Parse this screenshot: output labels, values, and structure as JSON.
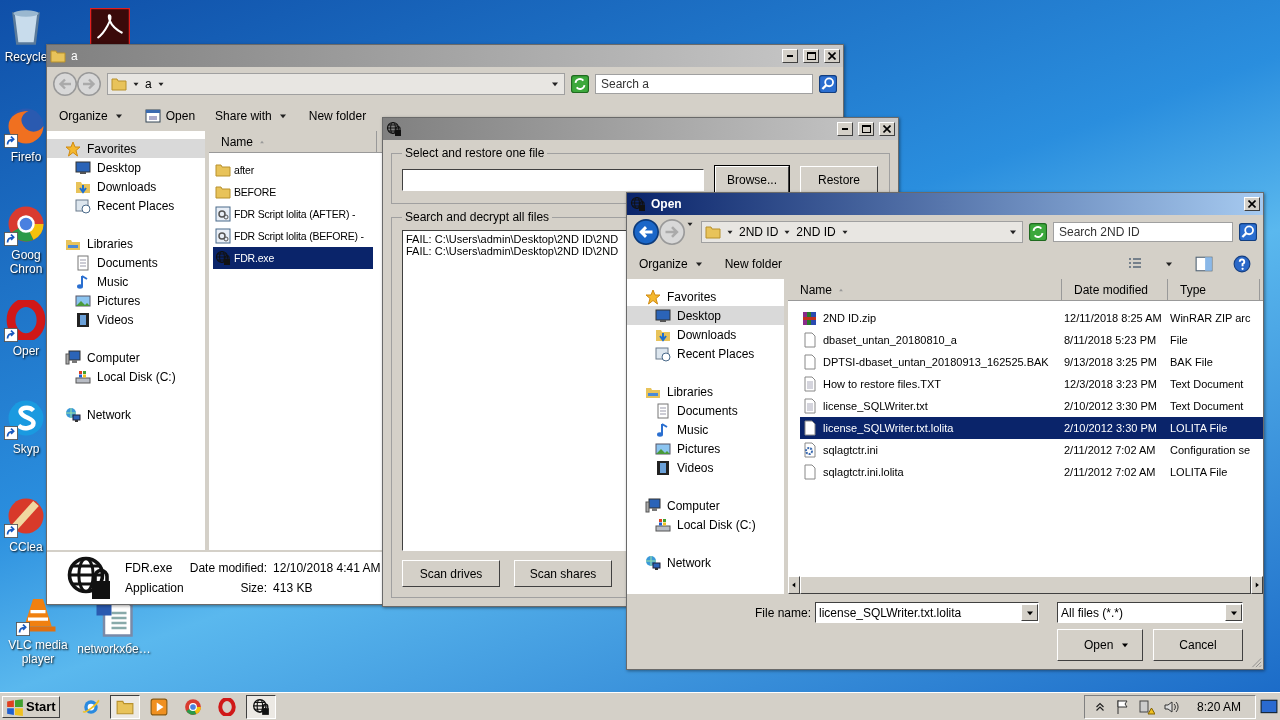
{
  "desktop_icons": [
    {
      "label": "Recycle"
    },
    {
      "label": "Firefo"
    },
    {
      "label": "Goog Chron"
    },
    {
      "label": "Oper"
    },
    {
      "label": "Skyp"
    },
    {
      "label": "CClea"
    },
    {
      "label": "VLC media player"
    },
    {
      "label": "networkxбe…"
    }
  ],
  "explorer": {
    "title": "a",
    "active": false,
    "breadcrumb": [
      "a"
    ],
    "search_placeholder": "Search a",
    "toolbar": [
      {
        "label": "Organize",
        "kind": "menu"
      },
      {
        "label": "Open",
        "kind": "icon"
      },
      {
        "label": "Share with",
        "kind": "menu"
      },
      {
        "label": "New folder",
        "kind": "plain"
      }
    ],
    "column": "Name",
    "nav": [
      {
        "label": "Favorites",
        "selected": true,
        "children": [
          {
            "label": "Desktop",
            "selected": false
          },
          {
            "label": "Downloads",
            "selected": false
          },
          {
            "label": "Recent Places",
            "selected": false
          }
        ]
      },
      {
        "label": "Libraries",
        "selected": false,
        "children": [
          {
            "label": "Documents",
            "selected": false
          },
          {
            "label": "Music",
            "selected": false
          },
          {
            "label": "Pictures",
            "selected": false
          },
          {
            "label": "Videos",
            "selected": false
          }
        ]
      },
      {
        "label": "Computer",
        "selected": false,
        "children": [
          {
            "label": "Local Disk (C:)",
            "selected": false
          }
        ]
      },
      {
        "label": "Network",
        "selected": false
      }
    ],
    "files": [
      {
        "name": "after",
        "selected": false
      },
      {
        "name": "BEFORE",
        "selected": false
      },
      {
        "name": "FDR Script lolita (AFTER) -",
        "selected": false
      },
      {
        "name": "FDR Script lolita (BEFORE) -",
        "selected": false
      },
      {
        "name": "FDR.exe",
        "selected": true
      }
    ],
    "details": {
      "name": "FDR.exe",
      "type": "Application",
      "date_label": "Date modified:",
      "date": "12/10/2018 4:41 AM",
      "size_label": "Size:",
      "size": "413 KB"
    }
  },
  "tool": {
    "active": false,
    "restore_group": "Select and restore one file",
    "browse": "Browse...",
    "restore": "Restore",
    "scan_group": "Search and decrypt all files",
    "log": [
      "FAIL: C:\\Users\\admin\\Desktop\\2ND ID\\2ND",
      "FAIL: C:\\Users\\admin\\Desktop\\2ND ID\\2ND"
    ],
    "scan_drives": "Scan drives",
    "scan_shares": "Scan shares"
  },
  "open": {
    "title": "Open",
    "active": true,
    "breadcrumb": [
      "2ND ID",
      "2ND ID"
    ],
    "search_placeholder": "Search 2ND ID",
    "toolbar": [
      {
        "label": "Organize",
        "kind": "menu"
      },
      {
        "label": "New folder",
        "kind": "plain"
      }
    ],
    "columns": [
      "Name",
      "Date modified",
      "Type"
    ],
    "nav": [
      {
        "label": "Favorites",
        "selected": false,
        "children": [
          {
            "label": "Desktop",
            "selected": true
          },
          {
            "label": "Downloads",
            "selected": false
          },
          {
            "label": "Recent Places",
            "selected": false
          }
        ]
      },
      {
        "label": "Libraries",
        "selected": false,
        "children": [
          {
            "label": "Documents",
            "selected": false
          },
          {
            "label": "Music",
            "selected": false
          },
          {
            "label": "Pictures",
            "selected": false
          },
          {
            "label": "Videos",
            "selected": false
          }
        ]
      },
      {
        "label": "Computer",
        "selected": false,
        "children": [
          {
            "label": "Local Disk (C:)",
            "selected": false
          }
        ]
      },
      {
        "label": "Network",
        "selected": false
      }
    ],
    "files": [
      {
        "name": "2ND ID.zip",
        "date": "12/11/2018 8:25 AM",
        "type": "WinRAR ZIP arc",
        "selected": false
      },
      {
        "name": "dbaset_untan_20180810_a",
        "date": "8/11/2018 5:23 PM",
        "type": "File",
        "selected": false
      },
      {
        "name": "DPTSI-dbaset_untan_20180913_162525.BAK",
        "date": "9/13/2018 3:25 PM",
        "type": "BAK File",
        "selected": false
      },
      {
        "name": "How to restore files.TXT",
        "date": "12/3/2018 3:23 PM",
        "type": "Text Document",
        "selected": false
      },
      {
        "name": "license_SQLWriter.txt",
        "date": "2/10/2012 3:30 PM",
        "type": "Text Document",
        "selected": false
      },
      {
        "name": "license_SQLWriter.txt.lolita",
        "date": "2/10/2012 3:30 PM",
        "type": "LOLITA File",
        "selected": true
      },
      {
        "name": "sqlagtctr.ini",
        "date": "2/11/2012 7:02 AM",
        "type": "Configuration se",
        "selected": false
      },
      {
        "name": "sqlagtctr.ini.lolita",
        "date": "2/11/2012 7:02 AM",
        "type": "LOLITA File",
        "selected": false
      }
    ],
    "file_name_label": "File name:",
    "file_name": "license_SQLWriter.txt.lolita",
    "filter": "All files (*.*)",
    "open_button": "Open",
    "cancel_button": "Cancel"
  },
  "taskbar": {
    "start": "Start",
    "apps": [
      {
        "selected": false
      },
      {
        "selected": true
      },
      {
        "selected": false
      },
      {
        "selected": false
      },
      {
        "selected": false
      },
      {
        "selected": true
      }
    ],
    "clock": "8:20 AM"
  }
}
